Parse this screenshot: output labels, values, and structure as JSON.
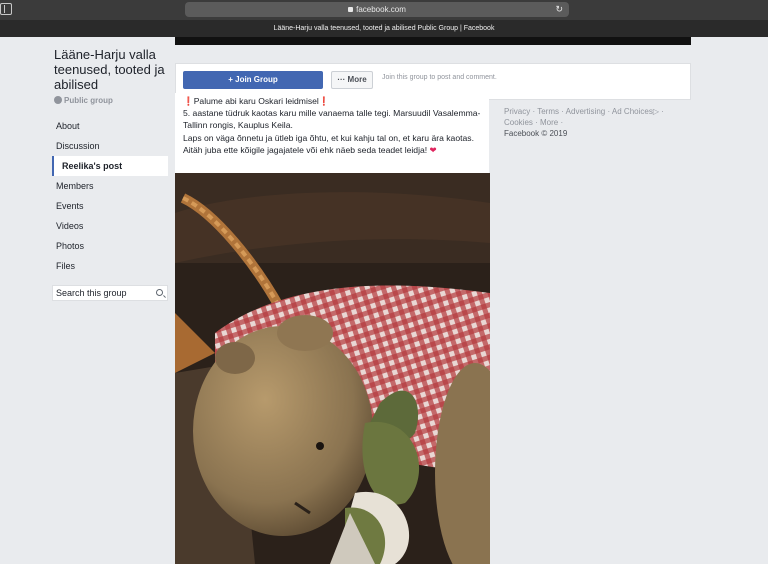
{
  "browser": {
    "address": "facebook.com",
    "tab_title": "Lääne-Harju valla teenused, tooted ja abilised Public Group | Facebook"
  },
  "group": {
    "title": "Lääne-Harju valla teenused, tooted ja abilised",
    "type": "Public group"
  },
  "nav": {
    "items": [
      "About",
      "Discussion",
      "Reelika's post",
      "Members",
      "Events",
      "Videos",
      "Photos",
      "Files"
    ],
    "active_index": 2
  },
  "search": {
    "placeholder": "Search this group"
  },
  "actions": {
    "join_label": "+ Join Group",
    "more_label": "··· More",
    "join_prompt": "Join this group to post and comment."
  },
  "post": {
    "line1": "Palume abi karu Oskari leidmisel",
    "line2": "5. aastane tüdruk kaotas karu mille vanaema talle tegi. Marsuudil Vasalemma- Tallinn rongis, Kauplus Keila.",
    "line3": "Laps on väga õnnetu ja ütleb iga õhtu, et kui kahju tal on, et karu ära kaotas.",
    "line4": "Aitäh juba ette kõigile jagajatele või ehk näeb seda teadet leidja!",
    "mark": "❗",
    "heart": "❤"
  },
  "footer": {
    "links": [
      "Privacy",
      "Terms",
      "Advertising",
      "Ad Choices",
      "Cookies",
      "More"
    ],
    "copyright": "Facebook © 2019"
  },
  "colors": {
    "brand": "#4267b2",
    "page_bg": "#e9ebee"
  },
  "icons": [
    "sidebar-toggle-icon",
    "lock-icon",
    "reload-icon",
    "globe-icon",
    "search-icon",
    "ad-choices-icon",
    "heart-icon"
  ]
}
